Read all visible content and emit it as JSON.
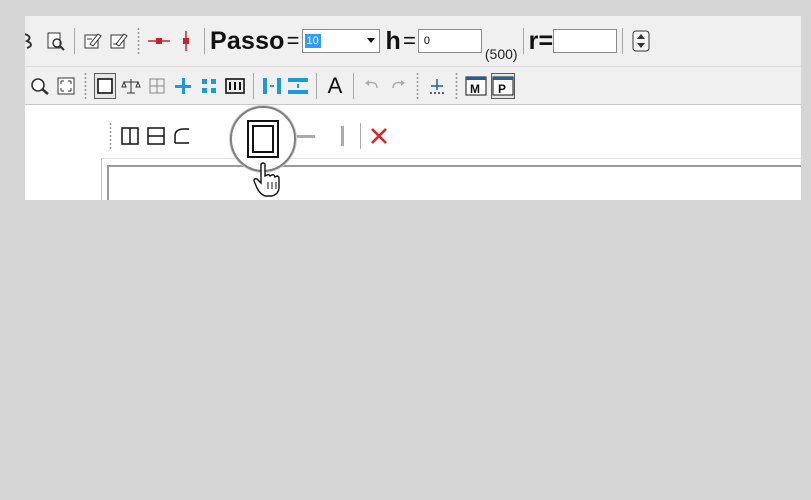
{
  "toolbar_row1": {
    "passo_label": "Passo",
    "equals": "=",
    "passo_value": "10",
    "h_label": "h",
    "h_value": "0",
    "h_max": "(500)",
    "r_label": "r=",
    "r_value": ""
  },
  "toolbar_row2": {
    "text_label": "A"
  },
  "colors": {
    "accent_blue": "#1aa3d9",
    "delete_red": "#d9262b"
  },
  "icons": {
    "row1": [
      "run-icon",
      "print-preview-icon",
      "edit-sheet-icon",
      "edit-sheet-2-icon",
      "horizontal-node-icon",
      "vertical-node-icon",
      "scroll-updown-icon"
    ],
    "row2": [
      "zoom-icon",
      "fit-screen-icon",
      "rectangle-select-icon",
      "balance-icon",
      "grid-snap-icon",
      "cross-icon",
      "split-vertical-icon",
      "columns-icon",
      "align-left-icon",
      "align-center-icon",
      "text-icon",
      "undo-icon",
      "redo-icon",
      "axis-icon",
      "m-frame-icon",
      "p-frame-icon"
    ],
    "row3": [
      "split-vertical-frame-icon",
      "split-horizontal-frame-icon",
      "curved-frame-icon",
      "full-frame-icon",
      "double-column-icon",
      "horizontal-line-icon",
      "vertical-line-icon",
      "delete-icon"
    ]
  }
}
